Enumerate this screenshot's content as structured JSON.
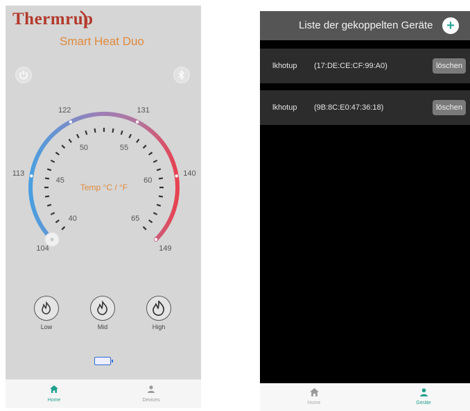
{
  "left_screen": {
    "brand": "Thermrup",
    "product": "Smart Heat Duo",
    "gauge": {
      "outer_labels": [
        "104",
        "113",
        "122",
        "131",
        "140",
        "149"
      ],
      "inner_labels": [
        "40",
        "45",
        "50",
        "55",
        "60",
        "65"
      ],
      "center_text": "Temp °C / °F",
      "min": 104,
      "max": 149,
      "current": 104
    },
    "heat_levels": [
      "Low",
      "Mid",
      "High"
    ],
    "nav": {
      "home": "Home",
      "devices": "Devices"
    },
    "colors": {
      "accent": "#e08a3c",
      "cold": "#4a9fe0",
      "hot": "#e8414f",
      "nav_active": "#1fa08e"
    }
  },
  "right_screen": {
    "title": "Liste der gekoppelten Geräte",
    "devices": [
      {
        "name": "lkhotup",
        "mac": "(17:DE:CE:CF:99:A0)",
        "action": "löschen"
      },
      {
        "name": "lkhotup",
        "mac": "(9B:8C:E0:47:36:18)",
        "action": "löschen"
      }
    ],
    "nav": {
      "home": "Home",
      "devices": "Geräte"
    }
  }
}
